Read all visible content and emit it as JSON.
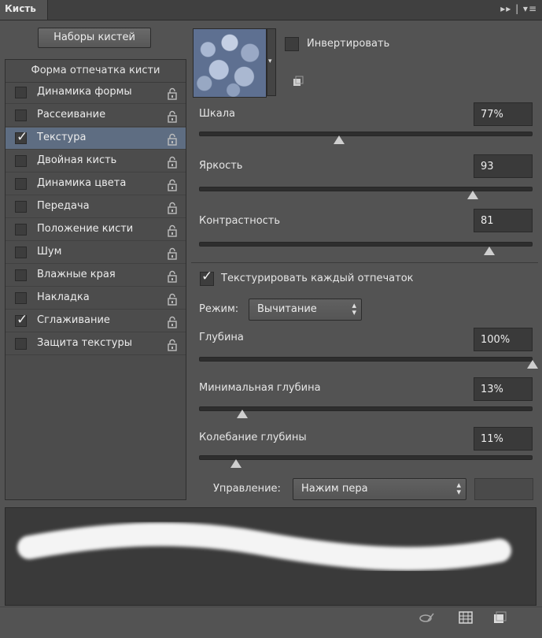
{
  "panel": {
    "title": "Кисть",
    "header_icons": "▸▸ | ▾≡"
  },
  "presets_button": "Наборы кистей",
  "list": {
    "header": "Форма отпечатка кисти",
    "items": [
      {
        "label": "Динамика формы",
        "checked": false,
        "selected": false
      },
      {
        "label": "Рассеивание",
        "checked": false,
        "selected": false
      },
      {
        "label": "Текстура",
        "checked": true,
        "selected": true
      },
      {
        "label": "Двойная кисть",
        "checked": false,
        "selected": false
      },
      {
        "label": "Динамика цвета",
        "checked": false,
        "selected": false
      },
      {
        "label": "Передача",
        "checked": false,
        "selected": false
      },
      {
        "label": "Положение кисти",
        "checked": false,
        "selected": false
      },
      {
        "label": "Шум",
        "checked": false,
        "selected": false
      },
      {
        "label": "Влажные края",
        "checked": false,
        "selected": false
      },
      {
        "label": "Накладка",
        "checked": false,
        "selected": false
      },
      {
        "label": "Сглаживание",
        "checked": true,
        "selected": false
      },
      {
        "label": "Защита текстуры",
        "checked": false,
        "selected": false
      }
    ]
  },
  "texture": {
    "invert_label": "Инвертировать",
    "invert_checked": false,
    "scale": {
      "label": "Шкала",
      "value": "77%",
      "level": 0.42
    },
    "brightness": {
      "label": "Яркость",
      "value": "93",
      "level": 0.82
    },
    "contrast": {
      "label": "Контрастность",
      "value": "81",
      "level": 0.87
    },
    "texture_each_tip": {
      "label": "Текстурировать каждый отпечаток",
      "checked": true
    },
    "mode": {
      "label": "Режим:",
      "value": "Вычитание"
    },
    "depth": {
      "label": "Глубина",
      "value": "100%",
      "level": 1.0
    },
    "min_depth": {
      "label": "Минимальная глубина",
      "value": "13%",
      "level": 0.13
    },
    "depth_jitter": {
      "label": "Колебание глубины",
      "value": "11%",
      "level": 0.11
    },
    "control": {
      "label": "Управление:",
      "value": "Нажим пера"
    }
  },
  "check_glyph": "✓",
  "select_arrows": "▴▾",
  "icons": {
    "lock": "lock-icon",
    "new_preset": "new-preset-icon",
    "eye": "eye-brush-icon",
    "grid": "grid-icon",
    "page": "new-page-icon"
  }
}
